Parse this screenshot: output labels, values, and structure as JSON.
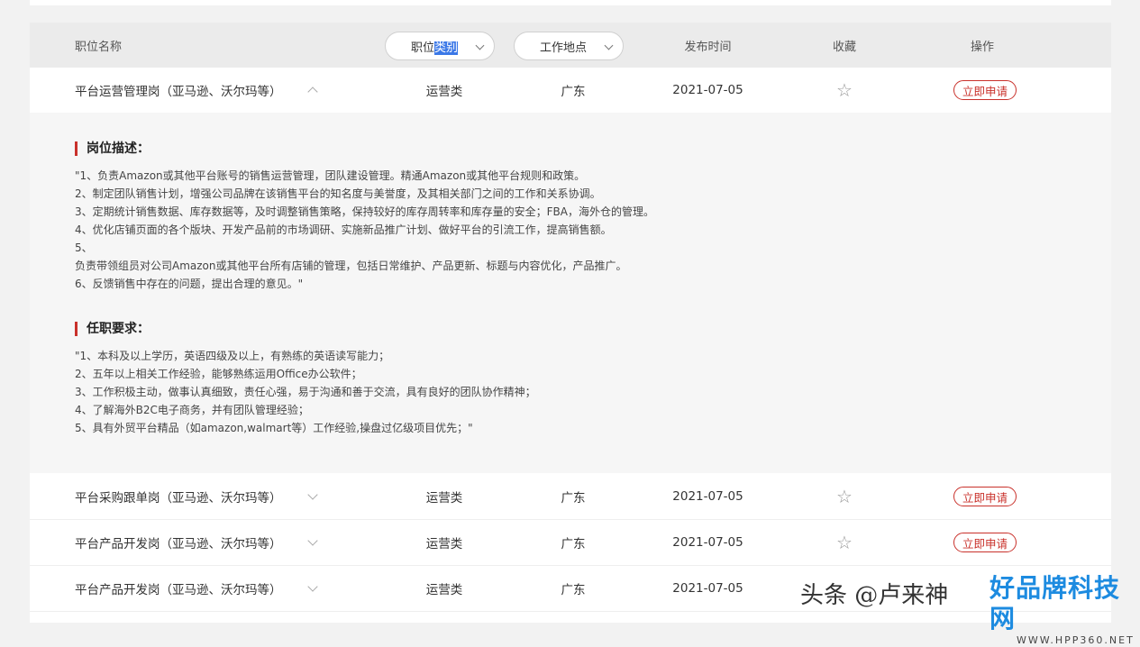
{
  "header": {
    "col_name": "职位名称",
    "filter_category_prefix": "职位",
    "filter_category_selected": "类别",
    "filter_location": "工作地点",
    "col_time": "发布时间",
    "col_fav": "收藏",
    "col_op": "操作"
  },
  "rows": [
    {
      "title": "平台运营管理岗（亚马逊、沃尔玛等）",
      "category": "运营类",
      "location": "广东",
      "date": "2021-07-05",
      "apply": "立即申请",
      "expanded": true
    },
    {
      "title": "平台采购跟单岗（亚马逊、沃尔玛等）",
      "category": "运营类",
      "location": "广东",
      "date": "2021-07-05",
      "apply": "立即申请",
      "expanded": false
    },
    {
      "title": "平台产品开发岗（亚马逊、沃尔玛等）",
      "category": "运营类",
      "location": "广东",
      "date": "2021-07-05",
      "apply": "立即申请",
      "expanded": false
    },
    {
      "title": "平台产品开发岗（亚马逊、沃尔玛等）",
      "category": "运营类",
      "location": "广东",
      "date": "2021-07-05",
      "apply": "",
      "expanded": false
    }
  ],
  "detail": {
    "desc_title": "岗位描述：",
    "desc_lines": [
      "\"1、负责Amazon或其他平台账号的销售运营管理，团队建设管理。精通Amazon或其他平台规则和政策。",
      "2、制定团队销售计划，增强公司品牌在该销售平台的知名度与美誉度，及其相关部门之间的工作和关系协调。",
      "3、定期统计销售数据、库存数据等，及时调整销售策略，保持较好的库存周转率和库存量的安全；FBA，海外仓的管理。",
      "4、优化店铺页面的各个版块、开发产品前的市场调研、实施新品推广计划、做好平台的引流工作，提高销售额。",
      "5、",
      "负责带领组员对公司Amazon或其他平台所有店铺的管理，包括日常维护、产品更新、标题与内容优化，产品推广。",
      "6、反馈销售中存在的问题，提出合理的意见。\""
    ],
    "req_title": "任职要求：",
    "req_lines": [
      "\"1、本科及以上学历，英语四级及以上，有熟练的英语读写能力；",
      "2、五年以上相关工作经验，能够熟练运用Office办公软件；",
      "3、工作积极主动，做事认真细致，责任心强，易于沟通和善于交流，具有良好的团队协作精神；",
      "4、了解海外B2C电子商务，并有团队管理经验；",
      "5、具有外贸平台精品（如amazon,walmart等）工作经验,操盘过亿级项目优先；\""
    ]
  },
  "watermark": {
    "text": "头条 @卢来神",
    "brand": "好品牌科技网",
    "brand_url": "WWW.HPP360.NET"
  },
  "colors": {
    "accent_red": "#c9312b",
    "selection_blue": "#3b78e7",
    "brand_blue": "#1d8be0"
  }
}
